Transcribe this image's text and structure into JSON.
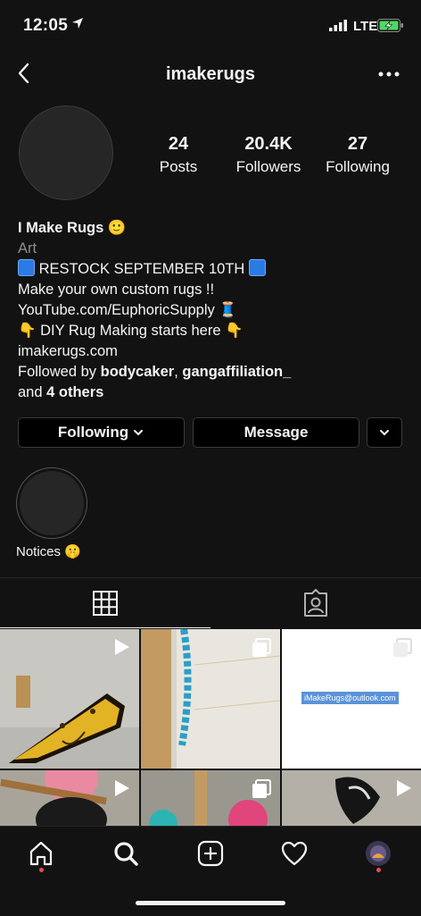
{
  "status_bar": {
    "time": "12:05",
    "network": "LTE",
    "icons": [
      "location-arrow-icon",
      "signal-icon",
      "battery-charging-icon"
    ]
  },
  "header": {
    "username": "imakerugs",
    "icons": [
      "back-chevron-icon",
      "more-options-icon"
    ]
  },
  "stats": [
    {
      "value": "24",
      "label": "Posts"
    },
    {
      "value": "20.4K",
      "label": "Followers"
    },
    {
      "value": "27",
      "label": "Following"
    }
  ],
  "bio": {
    "name": "I Make Rugs 🙂",
    "category": "Art",
    "restock": "RESTOCK SEPTEMBER 10TH",
    "line_custom": "Make your own custom rugs !!",
    "line_youtube": "YouTube.com/EuphoricSupply 🧵",
    "line_diy": "👇 DIY Rug Making starts here 👇",
    "website": "imakerugs.com",
    "followed_by_prefix": "Followed by ",
    "followed_by_user1": "bodycaker",
    "followed_by_sep": ", ",
    "followed_by_user2": "gangaffiliation_",
    "followed_by_and": "and ",
    "followed_by_others": "4 others"
  },
  "actions": {
    "following_label": "Following",
    "message_label": "Message"
  },
  "highlights": [
    {
      "label": "Notices 🤫"
    }
  ],
  "tabs": [
    "grid-icon",
    "tagged-icon"
  ],
  "posts": [
    {
      "kind": "reel",
      "icon": "play-icon"
    },
    {
      "kind": "carousel",
      "icon": "carousel-icon"
    },
    {
      "kind": "carousel",
      "icon": "carousel-icon",
      "text": "iMakeRugs@outlook.com"
    },
    {
      "kind": "reel",
      "icon": "play-icon"
    },
    {
      "kind": "carousel",
      "icon": "carousel-icon"
    },
    {
      "kind": "reel",
      "icon": "play-icon"
    }
  ],
  "bottom_nav": [
    "home-icon",
    "search-icon",
    "create-icon",
    "activity-heart-icon",
    "profile-avatar-icon"
  ]
}
